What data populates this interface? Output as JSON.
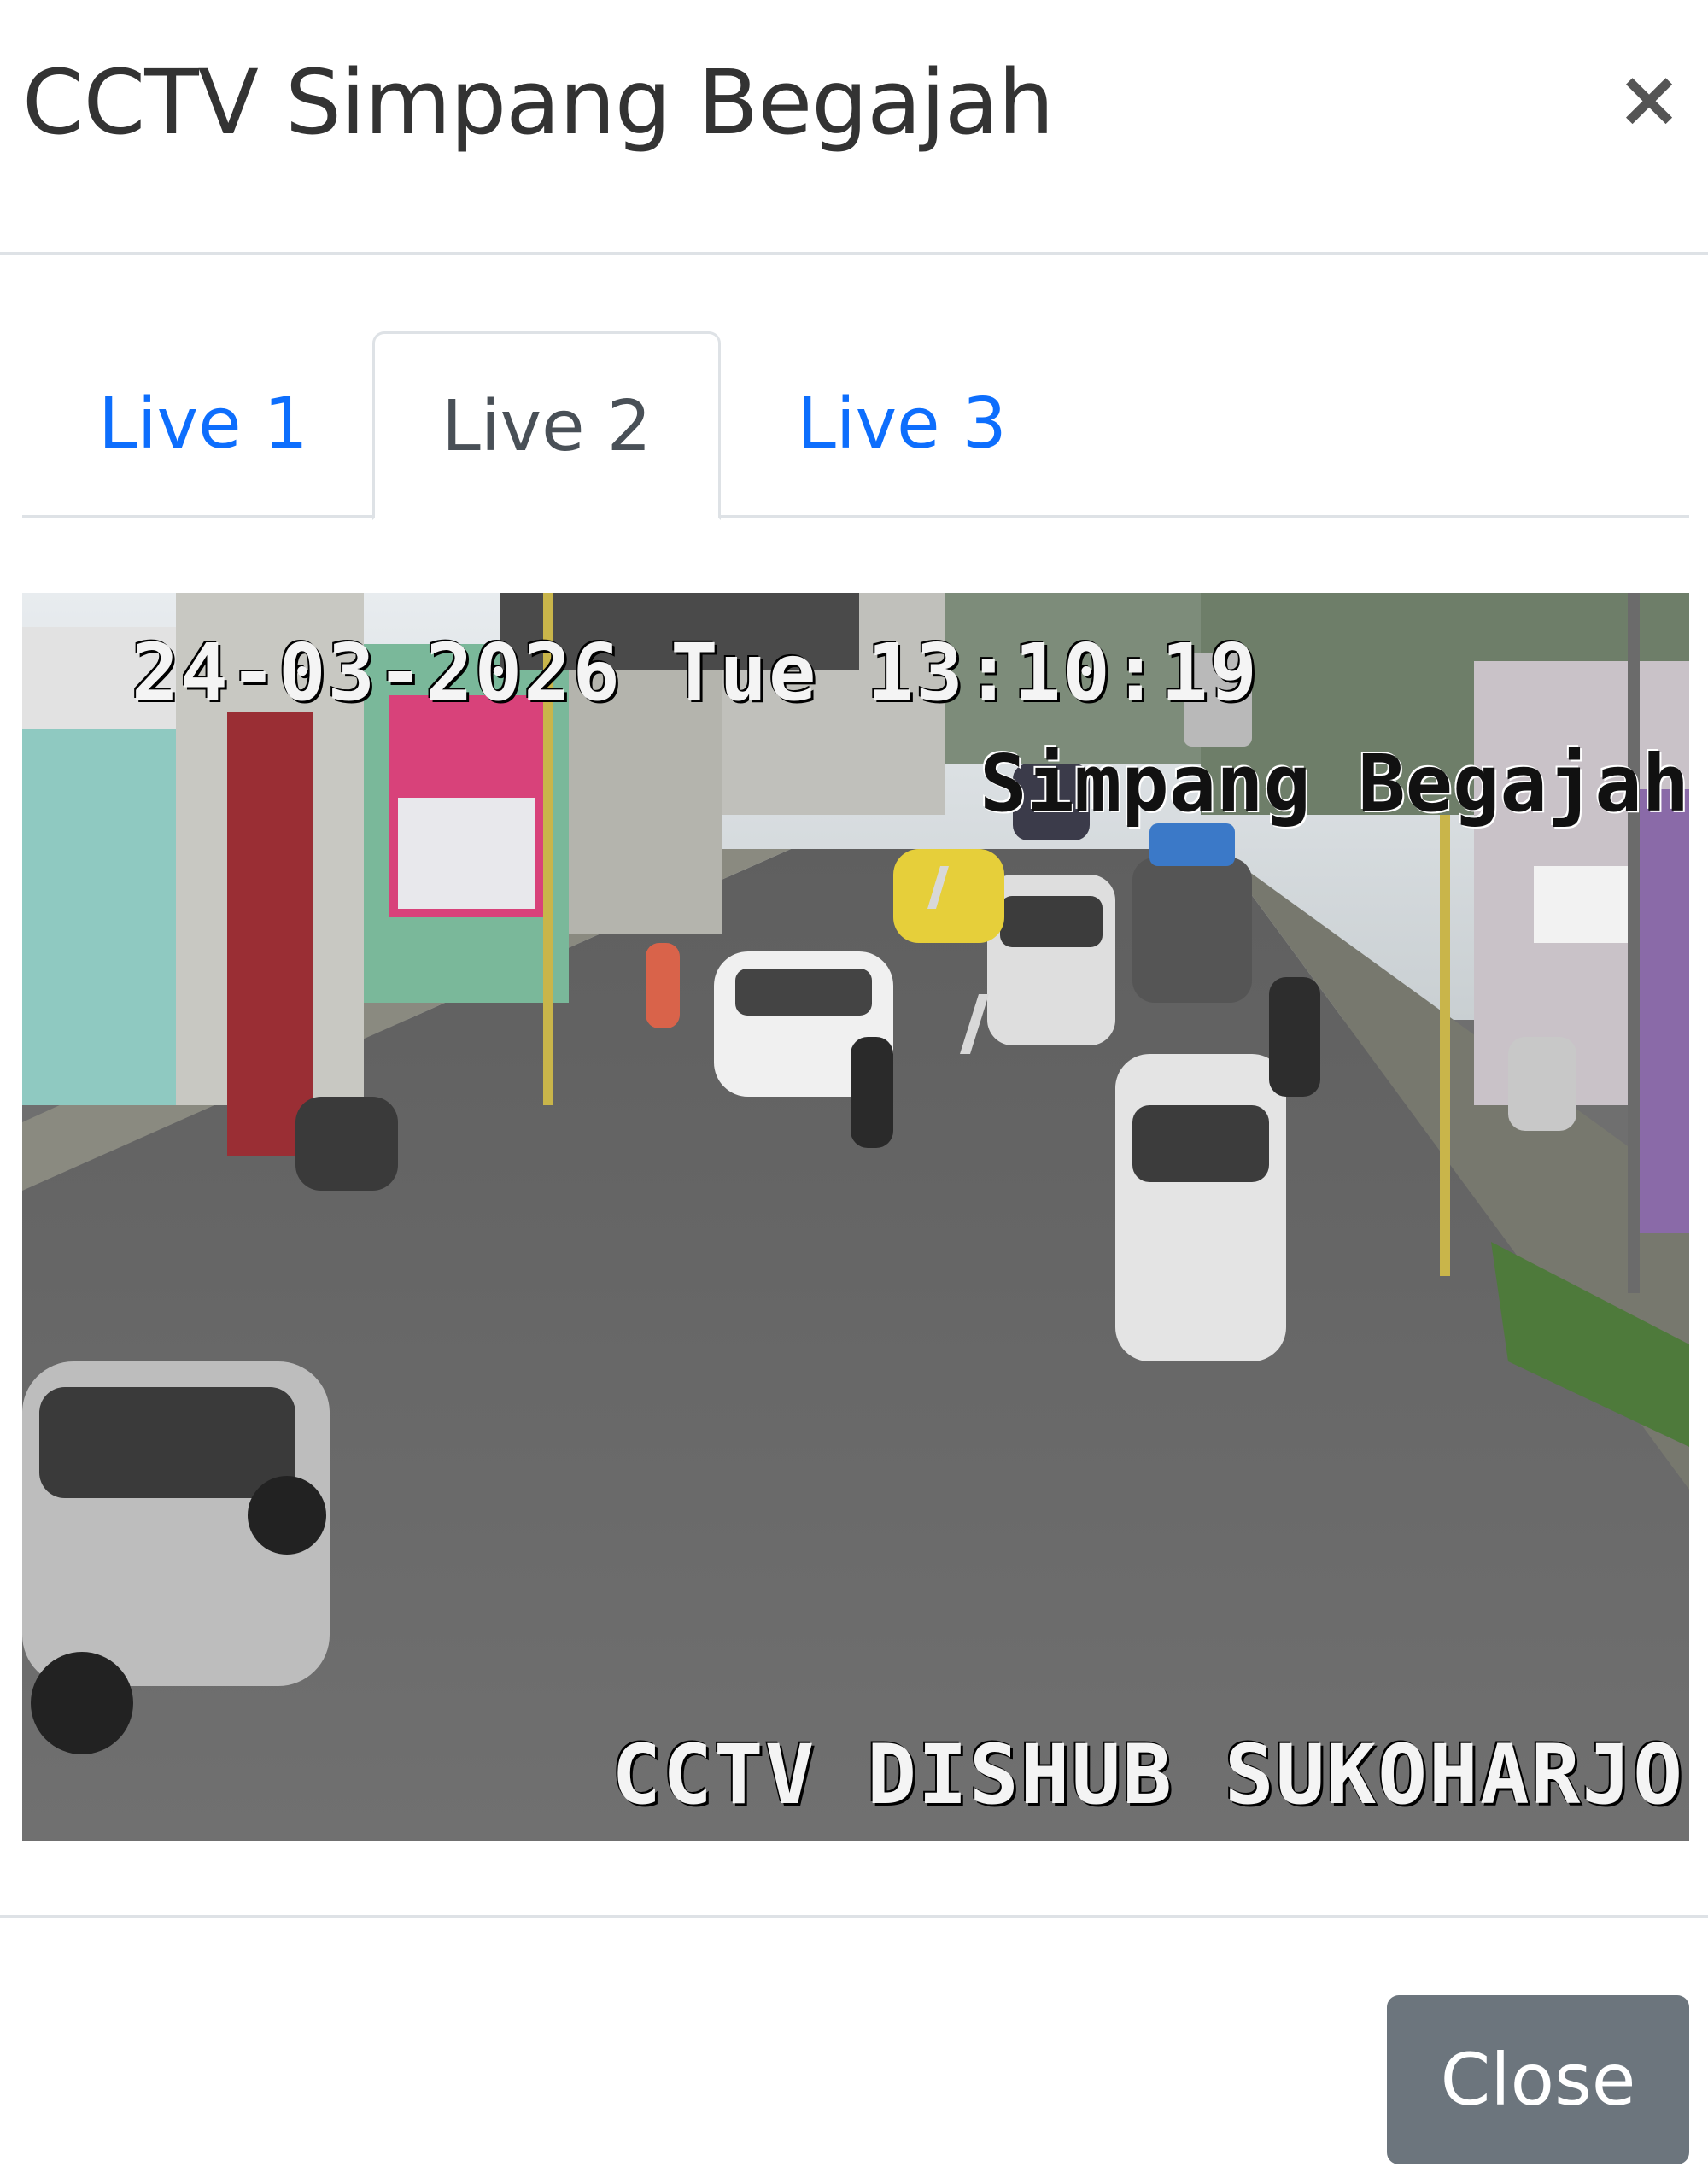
{
  "modal": {
    "title": "CCTV Simpang Begajah",
    "close_icon": "×",
    "close_button_label": "Close"
  },
  "tabs": [
    {
      "label": "Live 1",
      "active": false
    },
    {
      "label": "Live 2",
      "active": true
    },
    {
      "label": "Live 3",
      "active": false
    }
  ],
  "feed": {
    "timestamp": "24-03-2026 Tue 13:10:19",
    "location": "Simpang Begajah",
    "watermark": "CCTV DISHUB SUKOHARJO"
  },
  "colors": {
    "tab_link": "#0d6efd",
    "tab_active_text": "#495057",
    "button_bg": "#6c757d",
    "border": "#dee2e6"
  }
}
